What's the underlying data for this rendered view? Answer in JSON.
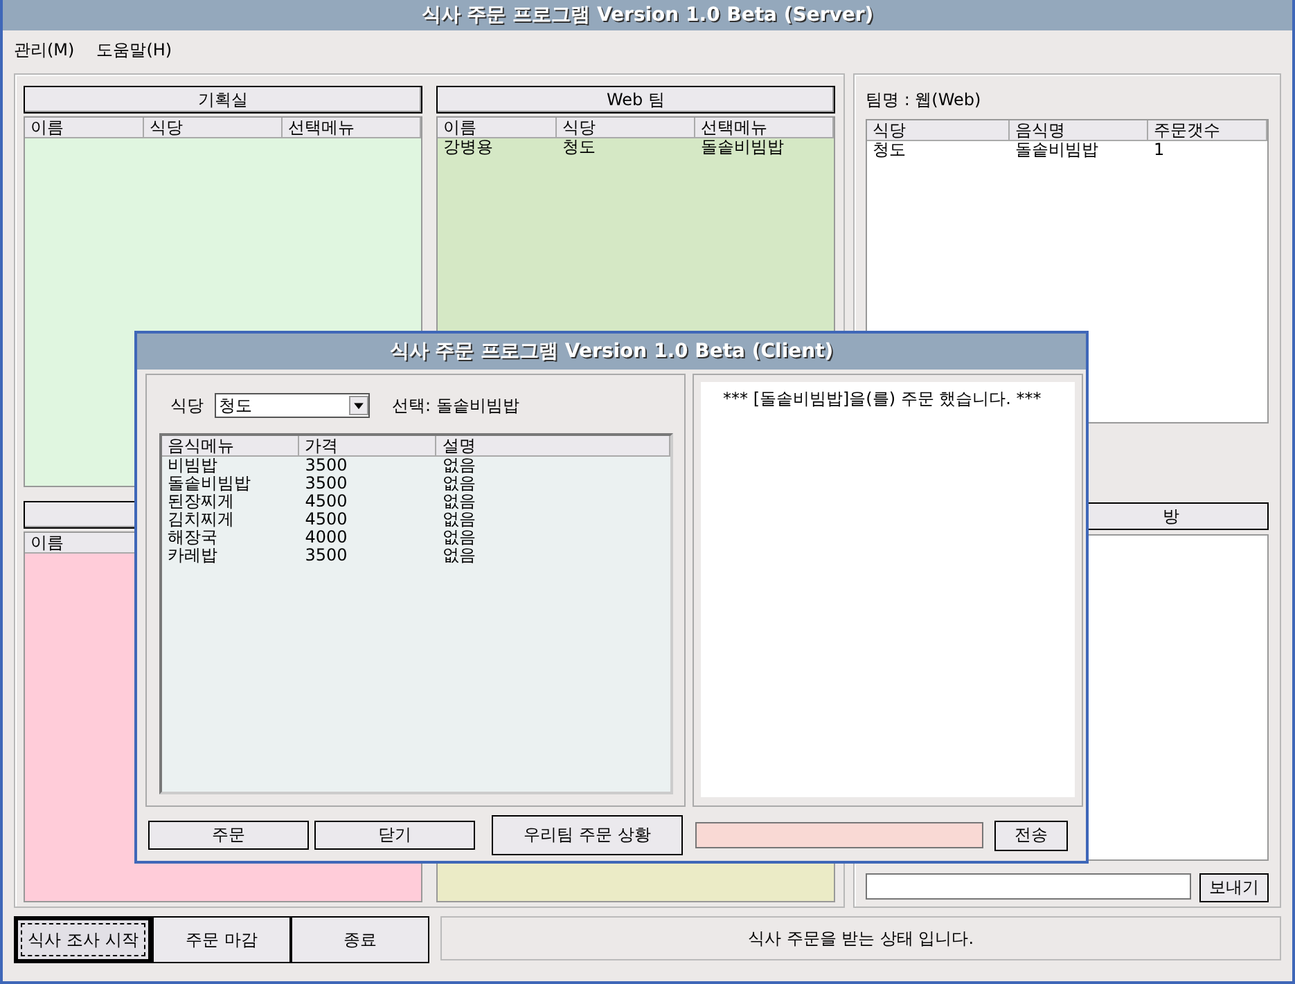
{
  "window": {
    "title": "식사 주문 프로그램 Version 1.0 Beta (Server)"
  },
  "menu": [
    {
      "label": "관리(M)"
    },
    {
      "label": "도움말(H)"
    }
  ],
  "teams": [
    {
      "title": "기획실",
      "columns": [
        "이름",
        "식당",
        "선택메뉴"
      ],
      "color": "#e0f6e0"
    },
    {
      "title": "Web 팀",
      "columns": [
        "이름",
        "식당",
        "선택메뉴"
      ],
      "rows": [
        [
          "강병용",
          "청도",
          "돌솥비빔밥"
        ]
      ],
      "color": "#d5e8c5"
    },
    {
      "columns": [
        "이름"
      ],
      "color": "#ffccd9"
    },
    {
      "color": "#ebebc6"
    }
  ],
  "summary": {
    "team_label": "팀명 : 웹(Web)",
    "columns": [
      "식당",
      "음식명",
      "주문갯수"
    ],
    "rows": [
      [
        "청도",
        "돌솥비빔밥",
        "1"
      ]
    ]
  },
  "chat": {
    "header": "방",
    "send_button": "보내기"
  },
  "bottom_buttons": [
    {
      "label": "식사 조사 시작",
      "focused": true
    },
    {
      "label": "주문 마감",
      "focused": false
    },
    {
      "label": "종료",
      "focused": false
    }
  ],
  "status": "식사 주문을 받는 상태 입니다.",
  "client": {
    "title": "식사 주문 프로그램 Version 1.0 Beta (Client)",
    "restaurant_label": "식당",
    "restaurant_value": "청도",
    "selection": "선택: 돌솥비빔밥",
    "menu_columns": [
      "음식메뉴",
      "가격",
      "설명"
    ],
    "menu_rows": [
      [
        "비빔밥",
        "3500",
        "없음"
      ],
      [
        "돌솥비빔밥",
        "3500",
        "없음"
      ],
      [
        "된장찌게",
        "4500",
        "없음"
      ],
      [
        "김치찌게",
        "4500",
        "없음"
      ],
      [
        "해장국",
        "4000",
        "없음"
      ],
      [
        "카레밥",
        "3500",
        "없음"
      ]
    ],
    "log": [
      "*** [돌솥비빔밥]을(를) 주문 했습니다. ***"
    ],
    "buttons": [
      "주문",
      "닫기"
    ],
    "status_button": "우리팀 주문 상황",
    "send_button": "전송"
  }
}
